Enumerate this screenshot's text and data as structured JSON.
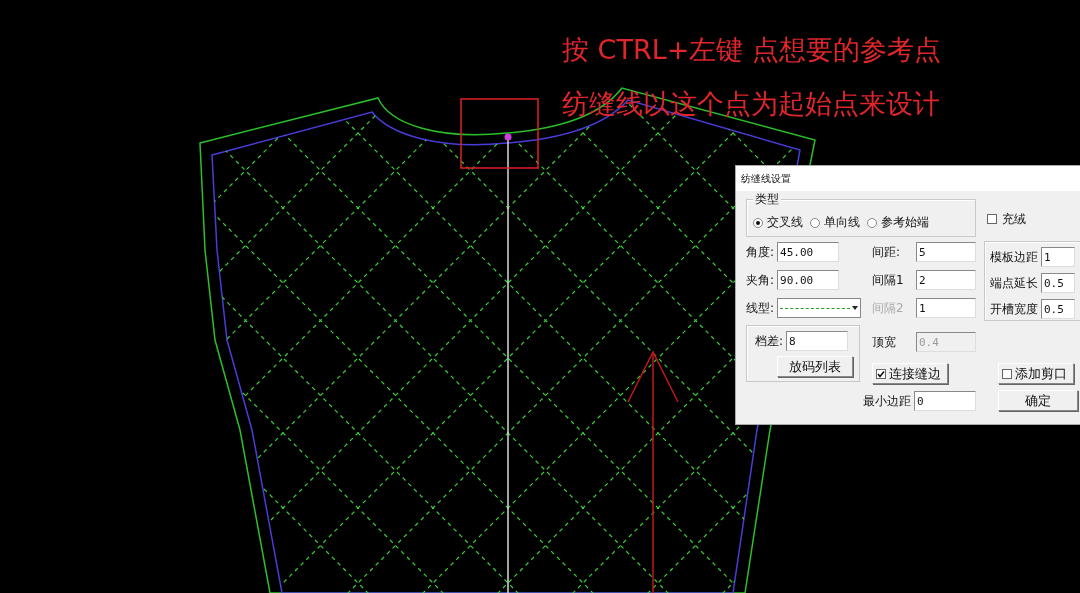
{
  "canvas": {
    "instructions": [
      "按 CTRL+左键  点想要的参考点",
      "纺缝线以这个点为起始点来设计"
    ]
  },
  "dialog": {
    "title": "纺缝线设置",
    "type_group": {
      "label": "类型",
      "options": [
        {
          "label": "交叉线",
          "selected": true
        },
        {
          "label": "单向线",
          "selected": false
        },
        {
          "label": "参考始端",
          "selected": false
        }
      ]
    },
    "fill_checkbox": {
      "label": "充绒",
      "checked": false
    },
    "left_fields": [
      {
        "label": "角度:",
        "value": "45.00"
      },
      {
        "label": "夹角:",
        "value": "90.00"
      }
    ],
    "line_type": {
      "label": "线型:"
    },
    "middle_fields": [
      {
        "label": "间距:",
        "value": "5",
        "label_disabled": false,
        "input_disabled": false
      },
      {
        "label": "间隔1",
        "value": "2",
        "label_disabled": false,
        "input_disabled": false
      },
      {
        "label": "间隔2",
        "value": "1",
        "label_disabled": true,
        "input_disabled": false
      }
    ],
    "top_width": {
      "label": "顶宽",
      "value": "0.4",
      "label_disabled": false,
      "input_disabled": true
    },
    "grade": {
      "label": "档差:",
      "value": "8",
      "button": "放码列表"
    },
    "connect_seam": {
      "label": "连接缝边",
      "checked": true
    },
    "min_margin": {
      "label": "最小边距",
      "value": "0"
    },
    "right_fields": [
      {
        "label": "模板边距",
        "value": "1"
      },
      {
        "label": "端点延长",
        "value": "0.5"
      },
      {
        "label": "开槽宽度",
        "value": "0.5"
      }
    ],
    "add_notch": {
      "label": "添加剪口",
      "checked": false
    },
    "ok_button": "确定"
  }
}
